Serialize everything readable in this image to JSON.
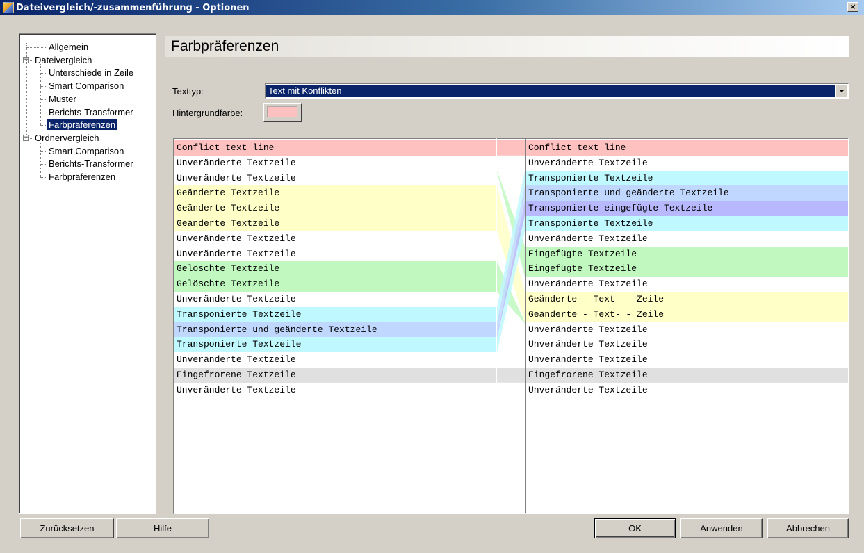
{
  "window": {
    "title": "Dateivergleich/-zusammenführung - Optionen",
    "close_label": "×"
  },
  "tree": {
    "items": [
      {
        "label": "Allgemein",
        "level": 1,
        "selected": false
      },
      {
        "label": "Dateivergleich",
        "level": 0,
        "expanded": true,
        "selected": false
      },
      {
        "label": "Unterschiede in Zeile",
        "level": 1,
        "selected": false
      },
      {
        "label": "Smart Comparison",
        "level": 1,
        "selected": false
      },
      {
        "label": "Muster",
        "level": 1,
        "selected": false
      },
      {
        "label": "Berichts-Transformer",
        "level": 1,
        "selected": false
      },
      {
        "label": "Farbpräferenzen",
        "level": 1,
        "selected": true
      },
      {
        "label": "Ordnervergleich",
        "level": 0,
        "expanded": true,
        "selected": false
      },
      {
        "label": "Smart Comparison",
        "level": 1,
        "selected": false
      },
      {
        "label": "Berichts-Transformer",
        "level": 1,
        "selected": false
      },
      {
        "label": "Farbpräferenzen",
        "level": 1,
        "selected": false
      }
    ]
  },
  "page": {
    "title": "Farbpräferenzen",
    "texttype_label": "Texttyp:",
    "texttype_value": "Text mit Konflikten",
    "bgcolor_label": "Hintergrundfarbe:",
    "bgcolor_value": "#ffc0c0"
  },
  "colors": {
    "conflict": "#ffc0c0",
    "changed": "#ffffc8",
    "deleted": "#c0f8c0",
    "inserted": "#c0f8c0",
    "transposed": "#c0f8ff",
    "transposed_changed": "#c0d8ff",
    "transposed_inserted": "#b8b8ff",
    "frozen": "#e0e0e0",
    "unchanged": "#ffffff",
    "selection": "#0a246a"
  },
  "preview": {
    "left_lines": [
      {
        "text": "Conflict text line",
        "kind": "conflict"
      },
      {
        "text": "Unveränderte Textzeile",
        "kind": "unchanged"
      },
      {
        "text": "Unveränderte Textzeile",
        "kind": "unchanged"
      },
      {
        "text": "Geänderte Textzeile",
        "kind": "changed"
      },
      {
        "text": "Geänderte Textzeile",
        "kind": "changed"
      },
      {
        "text": "Geänderte Textzeile",
        "kind": "changed"
      },
      {
        "text": "Unveränderte Textzeile",
        "kind": "unchanged"
      },
      {
        "text": "Unveränderte Textzeile",
        "kind": "unchanged"
      },
      {
        "text": "Gelöschte Textzeile",
        "kind": "deleted"
      },
      {
        "text": "Gelöschte Textzeile",
        "kind": "deleted"
      },
      {
        "text": "Unveränderte Textzeile",
        "kind": "unchanged"
      },
      {
        "text": "Transponierte Textzeile",
        "kind": "transposed"
      },
      {
        "text": "Transponierte und geänderte Textzeile",
        "kind": "transposed_changed"
      },
      {
        "text": "Transponierte Textzeile",
        "kind": "transposed"
      },
      {
        "text": "Unveränderte Textzeile",
        "kind": "unchanged"
      },
      {
        "text": "Eingefrorene Textzeile",
        "kind": "frozen"
      },
      {
        "text": "Unveränderte Textzeile",
        "kind": "unchanged"
      }
    ],
    "right_lines": [
      {
        "text": "Conflict text line",
        "kind": "conflict"
      },
      {
        "text": "Unveränderte Textzeile",
        "kind": "unchanged"
      },
      {
        "text": "Transponierte Textzeile",
        "kind": "transposed"
      },
      {
        "text": "Transponierte und geänderte Textzeile",
        "kind": "transposed_changed"
      },
      {
        "text": "Transponierte eingefügte Textzeile",
        "kind": "transposed_inserted"
      },
      {
        "text": "Transponierte Textzeile",
        "kind": "transposed"
      },
      {
        "text": "Unveränderte Textzeile",
        "kind": "unchanged"
      },
      {
        "text": "Eingefügte Textzeile",
        "kind": "inserted"
      },
      {
        "text": "Eingefügte Textzeile",
        "kind": "inserted"
      },
      {
        "text": "Unveränderte Textzeile",
        "kind": "unchanged"
      },
      {
        "text": "Geänderte - Text- - Zeile",
        "kind": "changed"
      },
      {
        "text": "Geänderte - Text- - Zeile",
        "kind": "changed"
      },
      {
        "text": "Unveränderte Textzeile",
        "kind": "unchanged"
      },
      {
        "text": "Unveränderte Textzeile",
        "kind": "unchanged"
      },
      {
        "text": "Unveränderte Textzeile",
        "kind": "unchanged"
      },
      {
        "text": "Eingefrorene Textzeile",
        "kind": "frozen"
      },
      {
        "text": "Unveränderte Textzeile",
        "kind": "unchanged"
      }
    ]
  },
  "buttons": {
    "reset": "Zurücksetzen",
    "help": "Hilfe",
    "ok": "OK",
    "apply": "Anwenden",
    "cancel": "Abbrechen"
  }
}
